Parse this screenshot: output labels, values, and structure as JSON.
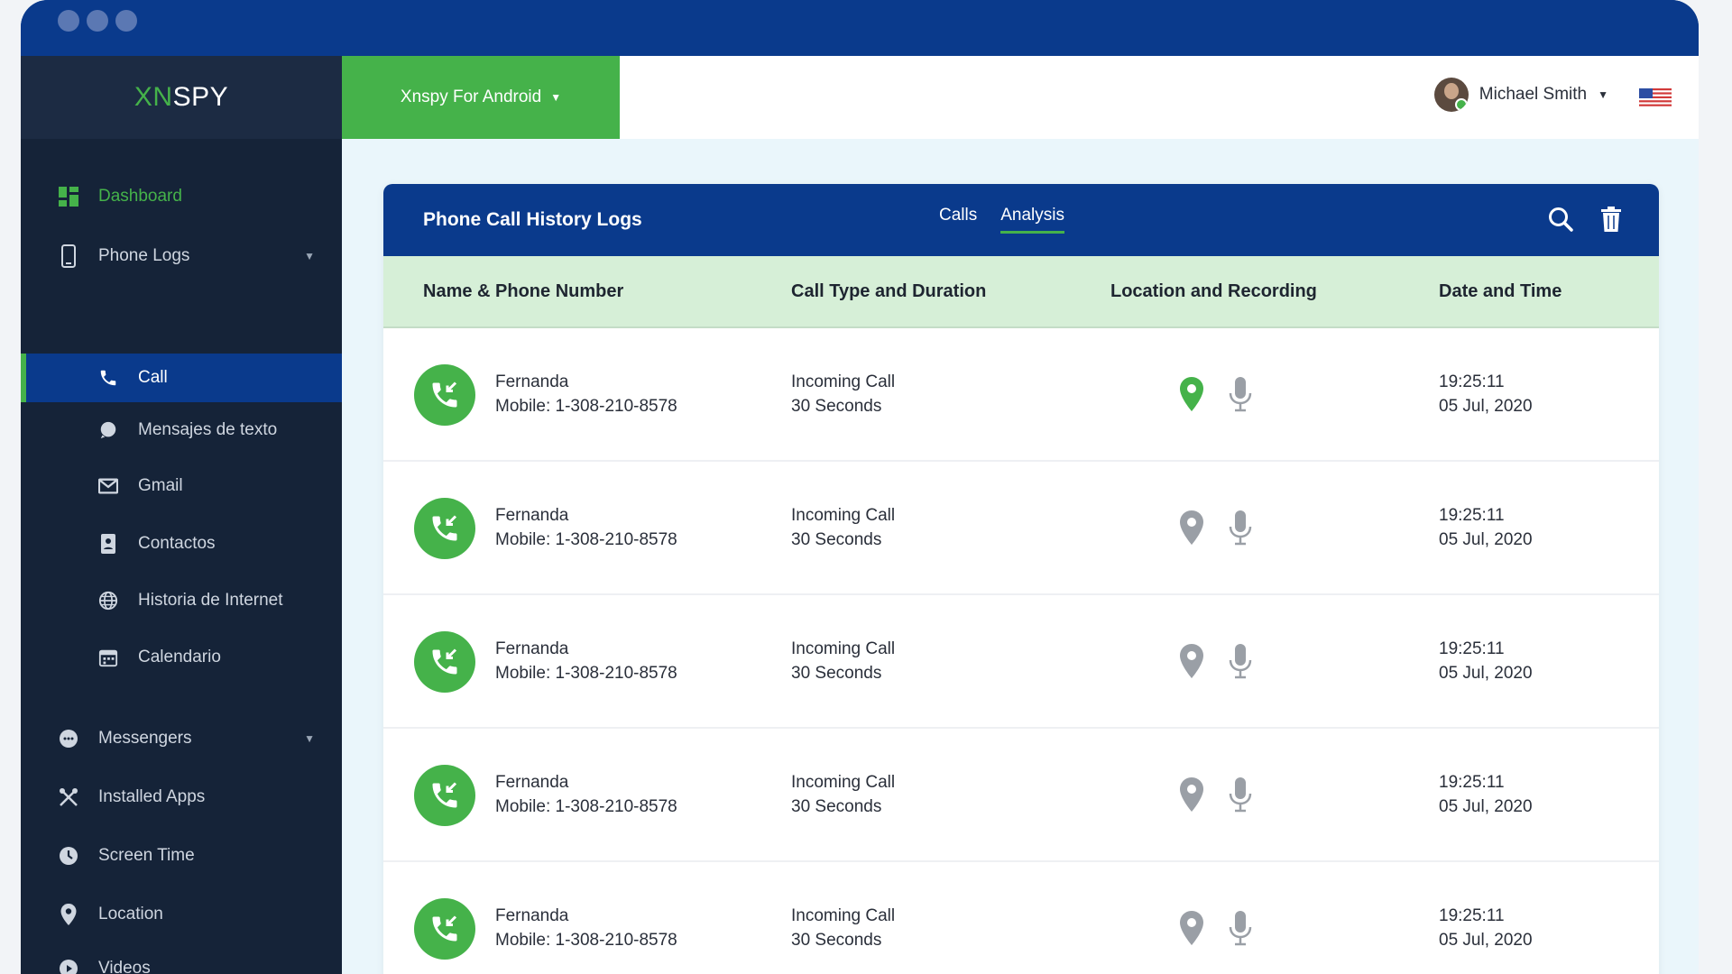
{
  "brand": {
    "logo_part1": "XN",
    "logo_part2": "SPY"
  },
  "topbar": {
    "device_label": "Xnspy For Android",
    "user_name": "Michael Smith"
  },
  "sidebar": {
    "items": [
      {
        "label": "Dashboard",
        "icon": "dashboard-icon"
      },
      {
        "label": "Phone Logs",
        "icon": "phone-icon"
      },
      {
        "label": "Call",
        "icon": "call-icon"
      },
      {
        "label": "Mensajes de texto",
        "icon": "message-icon"
      },
      {
        "label": "Gmail",
        "icon": "mail-icon"
      },
      {
        "label": "Contactos",
        "icon": "contacts-icon"
      },
      {
        "label": "Historia de Internet",
        "icon": "globe-icon"
      },
      {
        "label": "Calendario",
        "icon": "calendar-icon"
      },
      {
        "label": "Messengers",
        "icon": "chat-icon"
      },
      {
        "label": "Installed Apps",
        "icon": "tools-icon"
      },
      {
        "label": "Screen Time",
        "icon": "clock-icon"
      },
      {
        "label": "Location",
        "icon": "pin-icon"
      },
      {
        "label": "Videos",
        "icon": "video-icon"
      }
    ]
  },
  "card": {
    "title": "Phone Call History Logs",
    "tabs": [
      "Calls",
      "Analysis"
    ],
    "active_tab": "Analysis",
    "columns": [
      "Name & Phone Number",
      "Call Type and Duration",
      "Location and Recording",
      "Date and Time"
    ],
    "rows": [
      {
        "name": "Fernanda",
        "number": "Mobile: 1-308-210-8578",
        "type": "Incoming Call",
        "duration": "30 Seconds",
        "time": "19:25:11",
        "date": "05 Jul, 2020",
        "location_active": true
      },
      {
        "name": "Fernanda",
        "number": "Mobile: 1-308-210-8578",
        "type": "Incoming Call",
        "duration": "30 Seconds",
        "time": "19:25:11",
        "date": "05 Jul, 2020",
        "location_active": false
      },
      {
        "name": "Fernanda",
        "number": "Mobile: 1-308-210-8578",
        "type": "Incoming Call",
        "duration": "30 Seconds",
        "time": "19:25:11",
        "date": "05 Jul, 2020",
        "location_active": false
      },
      {
        "name": "Fernanda",
        "number": "Mobile: 1-308-210-8578",
        "type": "Incoming Call",
        "duration": "30 Seconds",
        "time": "19:25:11",
        "date": "05 Jul, 2020",
        "location_active": false
      },
      {
        "name": "Fernanda",
        "number": "Mobile: 1-308-210-8578",
        "type": "Incoming Call",
        "duration": "30 Seconds",
        "time": "19:25:11",
        "date": "05 Jul, 2020",
        "location_active": false
      }
    ]
  },
  "colors": {
    "brand_blue": "#0a3a8c",
    "brand_green": "#45b24a",
    "sidebar_bg": "#152338",
    "header_green": "#d6efd7",
    "icon_gray": "#9a9fa6"
  }
}
